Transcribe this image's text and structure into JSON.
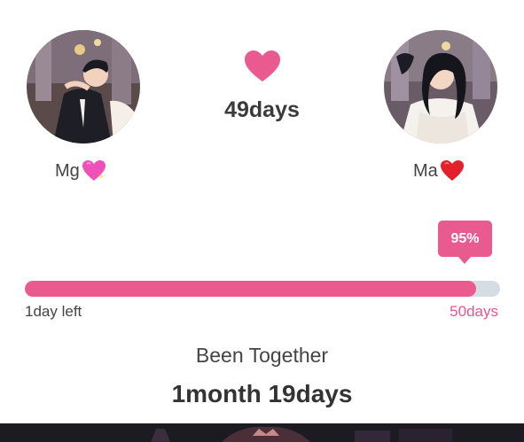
{
  "couple": {
    "left": {
      "name": "Mg",
      "emoji": "pink-sparkling-heart-icon"
    },
    "right": {
      "name": "Ma",
      "emoji": "red-heart-icon"
    }
  },
  "center": {
    "icon": "heart-icon",
    "days": "49days"
  },
  "progress": {
    "percent_label": "95%",
    "fraction": 0.95,
    "left_label": "1day left",
    "right_label": "50days"
  },
  "summary": {
    "caption": "Been Together",
    "duration": "1month 19days"
  },
  "colors": {
    "accent": "#e95b8f",
    "track": "#d5dce4",
    "text": "#333333"
  }
}
